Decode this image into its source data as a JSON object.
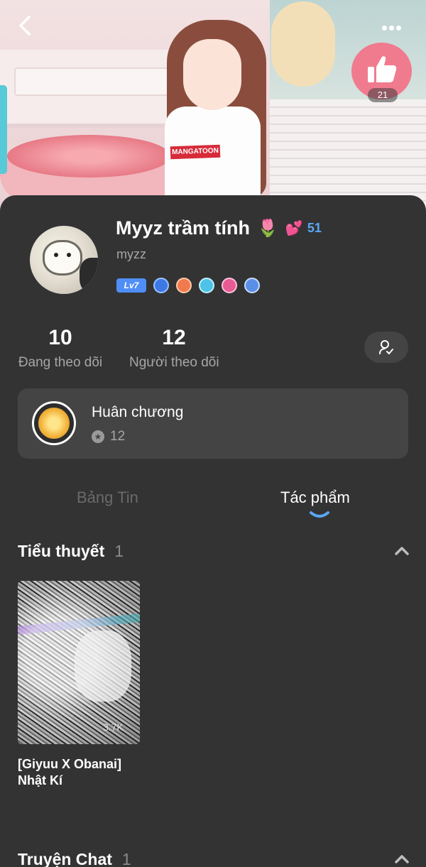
{
  "header": {
    "shirt_logo": "MANGATOON",
    "like_count": "21"
  },
  "profile": {
    "name": "Myyz trầm tính",
    "name_emoji": "🌷",
    "heart_emoji": "💕",
    "heart_count": "51",
    "username": "myzz",
    "level": "Lv7"
  },
  "stats": {
    "following_count": "10",
    "following_label": "Đang theo dõi",
    "followers_count": "12",
    "followers_label": "Người theo dõi"
  },
  "medals": {
    "title": "Huân chương",
    "count": "12"
  },
  "tabs": {
    "feed": "Bảng Tin",
    "works": "Tác phẩm",
    "active": "works"
  },
  "sections": {
    "novels": {
      "title": "Tiểu thuyết",
      "count": "1",
      "items": [
        {
          "title": "[Giyuu X Obanai] Nhật Kí",
          "views": "3.7K"
        }
      ]
    },
    "chat_stories": {
      "title": "Truyện Chat",
      "count": "1"
    }
  },
  "colors": {
    "background": "#333333",
    "card": "#444444",
    "accent_blue": "#5aa7f5",
    "level_badge": "#4f8ef7",
    "muted_text": "#a6a6a6"
  }
}
